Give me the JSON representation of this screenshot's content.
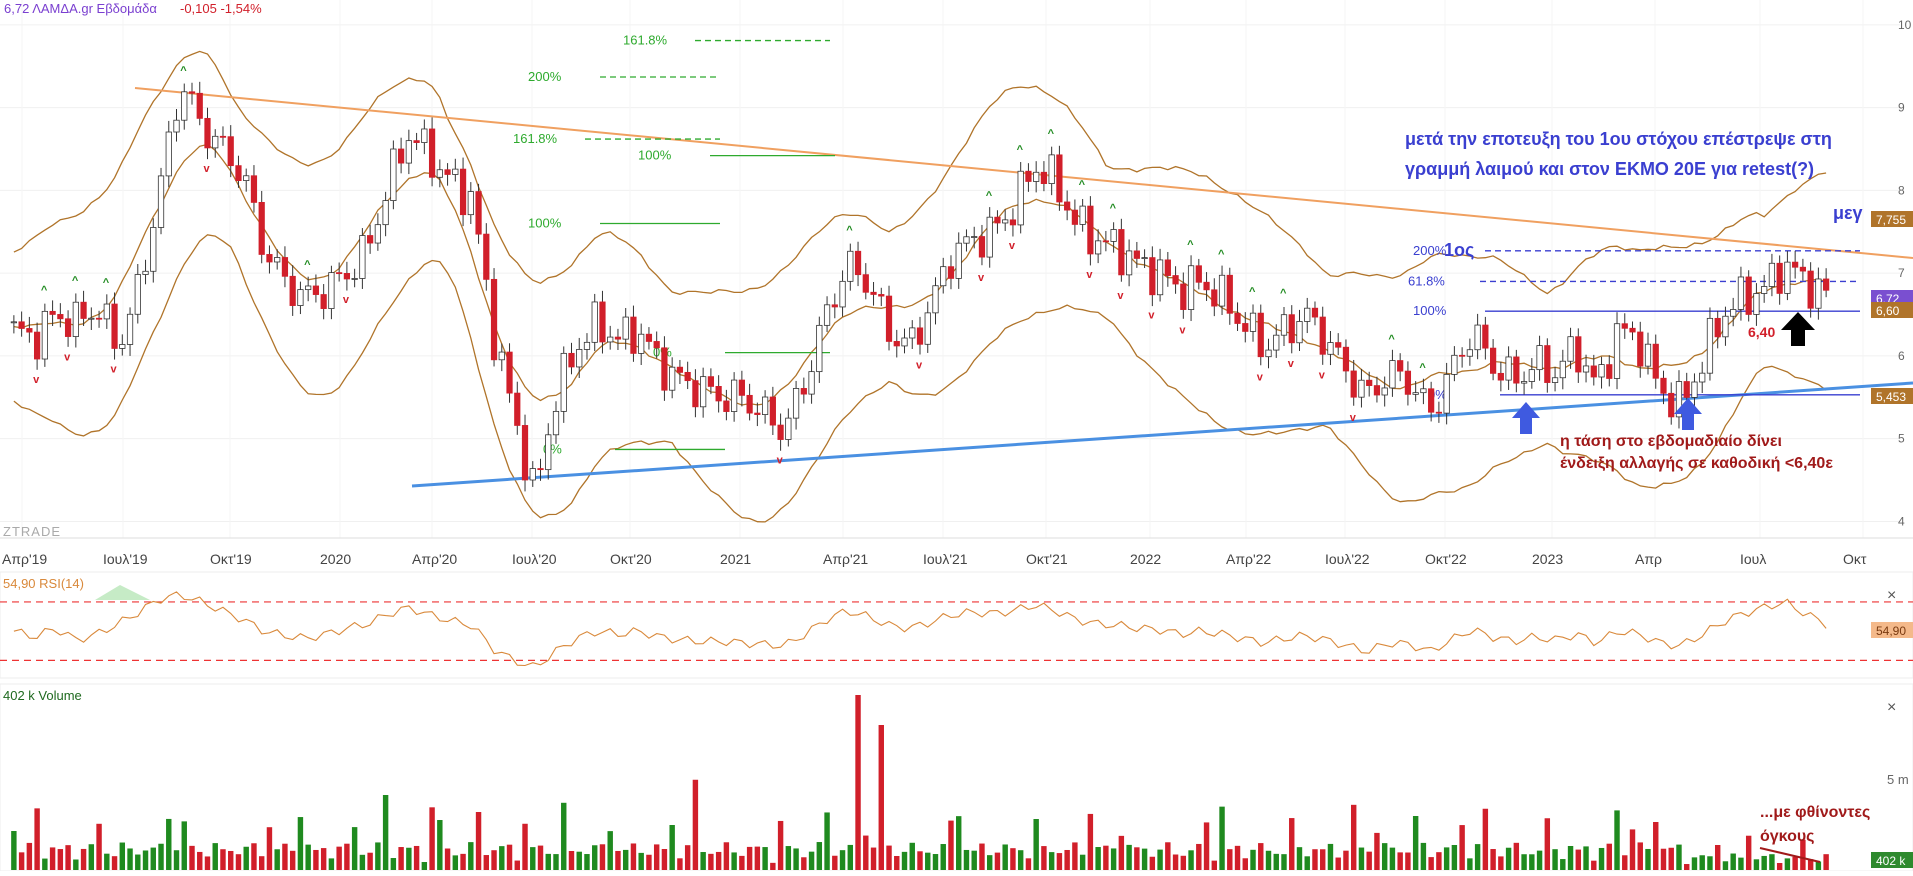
{
  "header": {
    "symbol_text": "6,72 ΛΑΜΔΑ.gr Εβδομάδα",
    "change_text": "-0,105 -1,54%"
  },
  "watermark": "ZTRADE",
  "colors": {
    "up": "#1f8a1f",
    "down": "#d11f2a",
    "bollinger": "#b0742a",
    "trendline_upper": "#f0a060",
    "trendline_lower": "#4a90e2",
    "fib_green": "#2eaa2e",
    "fib_blue": "#3a3fd0",
    "annotation_blue": "#3a3fd0",
    "annotation_red": "#a01a1a",
    "rsi_line": "#d9893b",
    "rsi_band": "#e33",
    "price_badge": "#7a4fd0",
    "bb_badge": "#b0742a"
  },
  "chart_data": [
    {
      "type": "candlestick",
      "title": "6,72 ΛΑΜΔΑ.gr Εβδομάδα",
      "ylim": [
        3.8,
        10.3
      ],
      "y_ticks": [
        "4",
        "5",
        "6",
        "7",
        "8",
        "9",
        "10"
      ],
      "x_ticks": [
        "Απρ'19",
        "Ιουλ'19",
        "Οκτ'19",
        "2020",
        "Απρ'20",
        "Ιουλ'20",
        "Οκτ'20",
        "2021",
        "Απρ'21",
        "Ιουλ'21",
        "Οκτ'21",
        "2022",
        "Απρ'22",
        "Ιουλ'22",
        "Οκτ'22",
        "2023",
        "Απρ",
        "Ιουλ",
        "Οκτ"
      ],
      "weekly_close_path": [
        6.3,
        6.2,
        6.5,
        6.4,
        6.6,
        6.1,
        6.8,
        8.0,
        9.3,
        8.8,
        8.5,
        8.2,
        7.3,
        6.9,
        6.7,
        6.8,
        7.0,
        7.3,
        8.1,
        8.7,
        8.4,
        8.1,
        7.9,
        6.3,
        5.3,
        4.3,
        5.5,
        6.1,
        6.4,
        6.2,
        6.3,
        5.9,
        5.7,
        5.6,
        5.5,
        5.5,
        5.3,
        5.1,
        5.7,
        6.5,
        7.1,
        6.9,
        6.3,
        6.1,
        6.6,
        7.2,
        7.4,
        7.5,
        7.8,
        8.3,
        8.1,
        7.6,
        7.4,
        7.3,
        7.1,
        7.0,
        6.8,
        6.9,
        6.7,
        6.4,
        6.1,
        6.3,
        6.5,
        6.2,
        5.8,
        5.5,
        5.8,
        5.7,
        5.3,
        5.8,
        6.3,
        5.9,
        5.7,
        5.9,
        5.8,
        6.1,
        5.6,
        6.3,
        6.2,
        5.6,
        5.4,
        5.9,
        6.5,
        6.7,
        6.8,
        7.1,
        6.9,
        6.72
      ],
      "price_labels": [
        "6,72",
        "6,60",
        "7,755",
        "5,453"
      ],
      "fib_levels": [
        {
          "label": "161.8%",
          "price": 9.81
        },
        {
          "label": "200%",
          "price": 9.37
        },
        {
          "label": "161.8%",
          "price": 8.62
        },
        {
          "label": "100%",
          "price": 8.42
        },
        {
          "label": "100%",
          "price": 7.6
        },
        {
          "label": "0%",
          "price": 6.04
        },
        {
          "label": "0%",
          "price": 4.87
        },
        {
          "label": "200%",
          "price": 7.27
        },
        {
          "label": "61.8%",
          "price": 6.9
        },
        {
          "label": "100%",
          "price": 6.54
        },
        {
          "label": "0%",
          "price": 5.53
        }
      ],
      "fib_prefix": "1ος",
      "target_label": "μεγ",
      "level_label": "6,40",
      "annotations": [
        "μετά την εποτευξη του 1ου στόχου επέστρεψε στη",
        "γραμμή λαιμού και στον ΕΚΜΟ 20Ε για retest(?)",
        "η τάση στο εβδομαδιαίο δίνει",
        "ένδειξη αλλαγής σε καθοδική <6,40ε"
      ]
    },
    {
      "type": "line",
      "title": "54,90 RSI(14)",
      "value_label": "54,90",
      "ylim": [
        20,
        85
      ],
      "bands": [
        70,
        30
      ],
      "values": [
        50,
        46,
        52,
        44,
        48,
        55,
        63,
        72,
        75,
        70,
        64,
        58,
        50,
        47,
        45,
        48,
        52,
        55,
        62,
        66,
        61,
        57,
        54,
        38,
        30,
        25,
        36,
        45,
        50,
        48,
        50,
        46,
        44,
        43,
        43,
        42,
        41,
        40,
        48,
        58,
        64,
        60,
        54,
        52,
        56,
        61,
        63,
        62,
        64,
        68,
        64,
        58,
        55,
        54,
        52,
        51,
        48,
        50,
        48,
        45,
        42,
        45,
        47,
        44,
        40,
        36,
        42,
        41,
        36,
        44,
        51,
        46,
        43,
        46,
        44,
        48,
        42,
        50,
        48,
        42,
        40,
        47,
        56,
        62,
        66,
        70,
        62,
        54.9
      ]
    },
    {
      "type": "bar",
      "title": "402 k Volume",
      "value_label": "402 k",
      "y_ticks": [
        "5 m"
      ],
      "annotation": [
        "...με φθίνοντες",
        "όγκους"
      ]
    }
  ]
}
